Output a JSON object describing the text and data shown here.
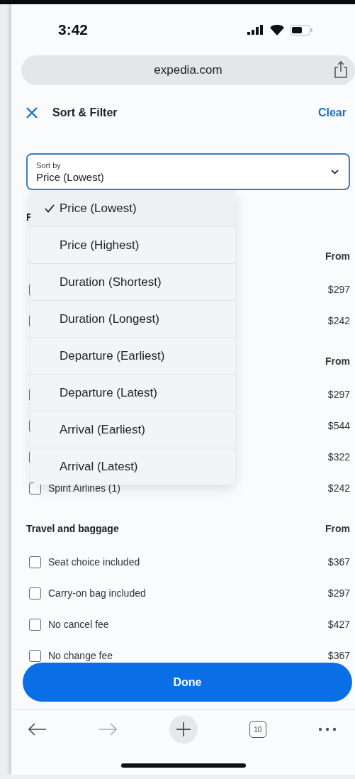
{
  "status_bar": {
    "time": "3:42"
  },
  "browser": {
    "url": "expedia.com"
  },
  "header": {
    "title": "Sort & Filter",
    "clear": "Clear"
  },
  "sort_field": {
    "label": "Sort by",
    "value": "Price (Lowest)",
    "expanded": true
  },
  "sort_options": [
    {
      "label": "Price (Lowest)",
      "selected": true
    },
    {
      "label": "Price (Highest)",
      "selected": false
    },
    {
      "label": "Duration (Shortest)",
      "selected": false
    },
    {
      "label": "Duration (Longest)",
      "selected": false
    },
    {
      "label": "Departure (Earliest)",
      "selected": false
    },
    {
      "label": "Departure (Latest)",
      "selected": false
    },
    {
      "label": "Arrival (Earliest)",
      "selected": false
    },
    {
      "label": "Arrival (Latest)",
      "selected": false
    }
  ],
  "filters_heading": "F",
  "sections": [
    {
      "from": "From",
      "rows": [
        {
          "price": "$297",
          "checked": false
        },
        {
          "price": "$242",
          "checked": false
        }
      ]
    },
    {
      "from": "From",
      "rows": [
        {
          "price": "$297",
          "checked": false
        },
        {
          "price": "$544",
          "checked": false
        },
        {
          "price": "$322",
          "checked": false
        },
        {
          "label": "Spirit Airlines (1)",
          "price": "$242",
          "checked": false
        }
      ]
    },
    {
      "heading": "Travel and baggage",
      "from": "From",
      "rows": [
        {
          "label": "Seat choice included",
          "price": "$367",
          "checked": false
        },
        {
          "label": "Carry-on bag included",
          "price": "$297",
          "checked": false
        },
        {
          "label": "No cancel fee",
          "price": "$427",
          "checked": false
        },
        {
          "label": "No change fee",
          "price": "$367",
          "checked": false
        }
      ]
    }
  ],
  "done_button": "Done",
  "toolbar": {
    "tab_count": "10"
  }
}
